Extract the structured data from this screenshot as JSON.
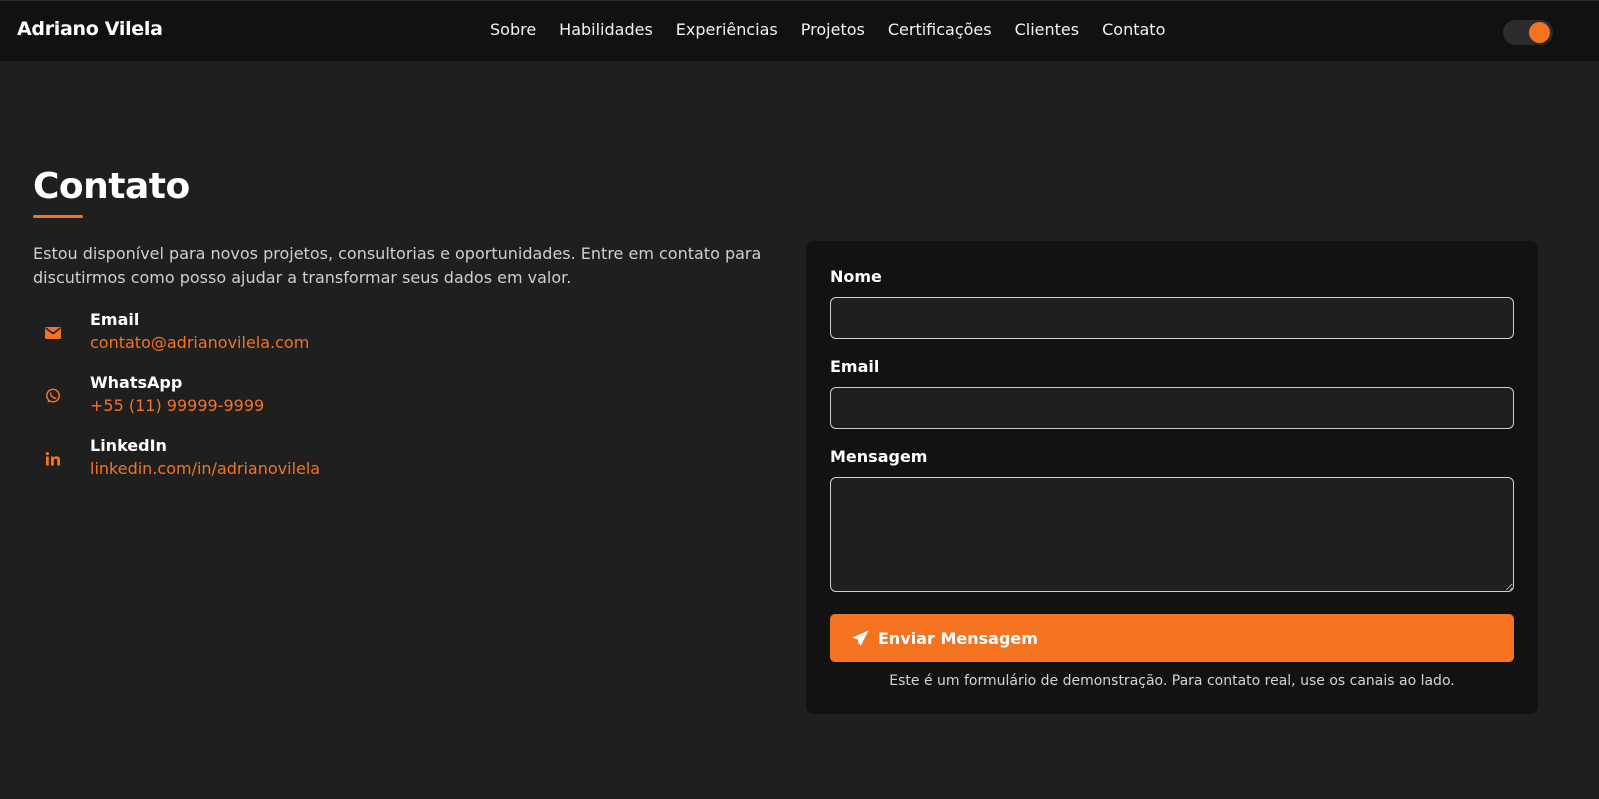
{
  "header": {
    "brand": "Adriano Vilela",
    "nav": [
      "Sobre",
      "Habilidades",
      "Experiências",
      "Projetos",
      "Certificações",
      "Clientes",
      "Contato"
    ],
    "theme_toggle_on": true
  },
  "contact": {
    "title": "Contato",
    "intro": "Estou disponível para novos projetos, consultorias e oportunidades. Entre em contato para discutirmos como posso ajudar a transformar seus dados em valor.",
    "items": [
      {
        "label": "Email",
        "value": "contato@adrianovilela.com",
        "icon": "envelope-icon"
      },
      {
        "label": "WhatsApp",
        "value": "+55 (11) 99999-9999",
        "icon": "whatsapp-icon"
      },
      {
        "label": "LinkedIn",
        "value": "linkedin.com/in/adrianovilela",
        "icon": "linkedin-icon"
      }
    ]
  },
  "form": {
    "name_label": "Nome",
    "name_value": "",
    "email_label": "Email",
    "email_value": "",
    "message_label": "Mensagem",
    "message_value": "",
    "submit_label": "Enviar Mensagem",
    "note": "Este é um formulário de demonstração. Para contato real, use os canais ao lado."
  },
  "colors": {
    "accent": "#f47321",
    "background": "#1f1f1f",
    "header_bg": "#111111",
    "card_bg": "#121212"
  }
}
